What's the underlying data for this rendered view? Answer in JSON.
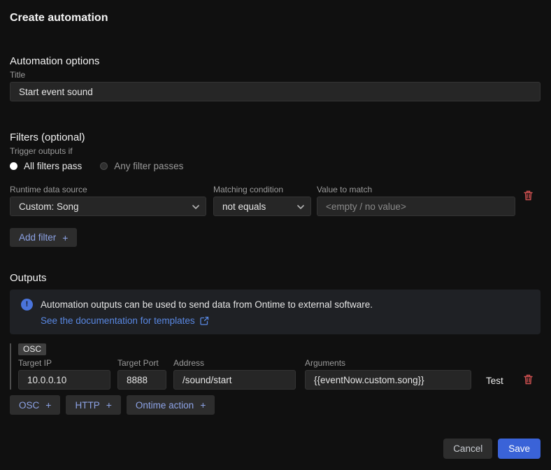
{
  "header": {
    "title": "Create automation"
  },
  "automation_options": {
    "heading": "Automation options",
    "title_label": "Title",
    "title_value": "Start event sound"
  },
  "filters": {
    "heading": "Filters (optional)",
    "trigger_label": "Trigger outputs if",
    "radio_all": "All filters pass",
    "radio_any": "Any filter passes",
    "source_label": "Runtime data source",
    "source_value": "Custom: Song",
    "condition_label": "Matching condition",
    "condition_value": "not equals",
    "value_label": "Value to match",
    "value_placeholder": "<empty / no value>",
    "add_filter_label": "Add filter",
    "plus": "+"
  },
  "outputs": {
    "heading": "Outputs",
    "info_text": "Automation outputs can be used to send data from Ontime to external software.",
    "info_link": "See the documentation for templates",
    "osc_row": {
      "badge": "OSC",
      "target_ip_label": "Target IP",
      "target_ip_value": "10.0.0.10",
      "target_port_label": "Target Port",
      "target_port_value": "8888",
      "address_label": "Address",
      "address_value": "/sound/start",
      "arguments_label": "Arguments",
      "arguments_value": "{{eventNow.custom.song}}",
      "test_label": "Test"
    },
    "add_buttons": [
      {
        "label": "OSC"
      },
      {
        "label": "HTTP"
      },
      {
        "label": "Ontime action"
      }
    ]
  },
  "footer": {
    "cancel_label": "Cancel",
    "save_label": "Save"
  },
  "icons": {
    "info": "info-icon",
    "info_glyph": "!",
    "external_link": "external-link-icon",
    "chevron_down": "chevron-down-icon",
    "trash": "trash-icon"
  },
  "colors": {
    "background": "#101010",
    "panel": "#1f2125",
    "accent_save": "#3a63d8",
    "link_blue": "#5988e3",
    "chip_text_blue": "#8da3e6",
    "danger_red": "#d15151",
    "badge_gray": "#3f3f3f"
  }
}
